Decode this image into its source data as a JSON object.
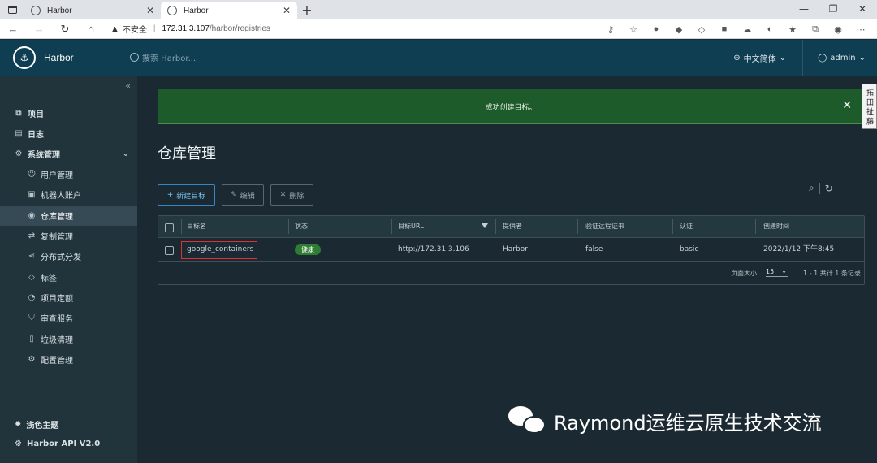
{
  "browser": {
    "tabs": [
      {
        "label": "Harbor",
        "active": false
      },
      {
        "label": "Harbor",
        "active": true
      }
    ],
    "new_tab": "+",
    "window_controls": [
      "—",
      "❐",
      "✕"
    ],
    "address": {
      "warning": "不安全",
      "host": "172.31.3.107",
      "path": "/harbor/registries"
    }
  },
  "header": {
    "brand": "Harbor",
    "search_placeholder": "搜索 Harbor...",
    "language": "中文简体",
    "user": "admin"
  },
  "sidebar": {
    "items": [
      {
        "label": "项目",
        "icon": "projects-icon",
        "level": "top"
      },
      {
        "label": "日志",
        "icon": "logs-icon",
        "level": "top"
      },
      {
        "label": "系统管理",
        "icon": "admin-icon",
        "level": "top"
      },
      {
        "label": "用户管理",
        "icon": "users-icon",
        "level": "sub"
      },
      {
        "label": "机器人账户",
        "icon": "robot-icon",
        "level": "sub"
      },
      {
        "label": "仓库管理",
        "icon": "registry-icon",
        "level": "sub",
        "active": true
      },
      {
        "label": "复制管理",
        "icon": "replication-icon",
        "level": "sub"
      },
      {
        "label": "分布式分发",
        "icon": "distribution-icon",
        "level": "sub"
      },
      {
        "label": "标签",
        "icon": "tag-icon",
        "level": "sub"
      },
      {
        "label": "项目定额",
        "icon": "quota-icon",
        "level": "sub"
      },
      {
        "label": "审查服务",
        "icon": "shield-icon",
        "level": "sub"
      },
      {
        "label": "垃圾清理",
        "icon": "trash-icon",
        "level": "sub"
      },
      {
        "label": "配置管理",
        "icon": "gear-icon",
        "level": "sub"
      }
    ],
    "theme": "浅色主题",
    "api": "Harbor API V2.0"
  },
  "alert": {
    "message": "成功创建目标。",
    "side_tab": "拓 田 扯 藤"
  },
  "page": {
    "title": "仓库管理",
    "buttons": {
      "new": "新建目标",
      "edit": "编辑",
      "delete": "删除"
    }
  },
  "table": {
    "columns": [
      "目标名",
      "状态",
      "目标URL",
      "提供者",
      "验证远程证书",
      "认证",
      "创建时间"
    ],
    "rows": [
      {
        "name": "google_containers",
        "status": "健康",
        "url": "http://172.31.3.106",
        "provider": "Harbor",
        "verify": "false",
        "auth": "basic",
        "created": "2022/1/12 下午8:45"
      }
    ],
    "footer": {
      "page_size_label": "页面大小",
      "page_size": "15",
      "summary": "1 - 1 共计 1 条记录"
    }
  },
  "watermark": "Raymond运维云原生技术交流",
  "colors": {
    "header": "#0f3d52",
    "sidebar": "#21333b",
    "content": "#1b2a32",
    "alert": "#1e5b2a",
    "primary": "#3a86c4",
    "status_ok": "#2e7d32",
    "highlight": "#e03030"
  }
}
